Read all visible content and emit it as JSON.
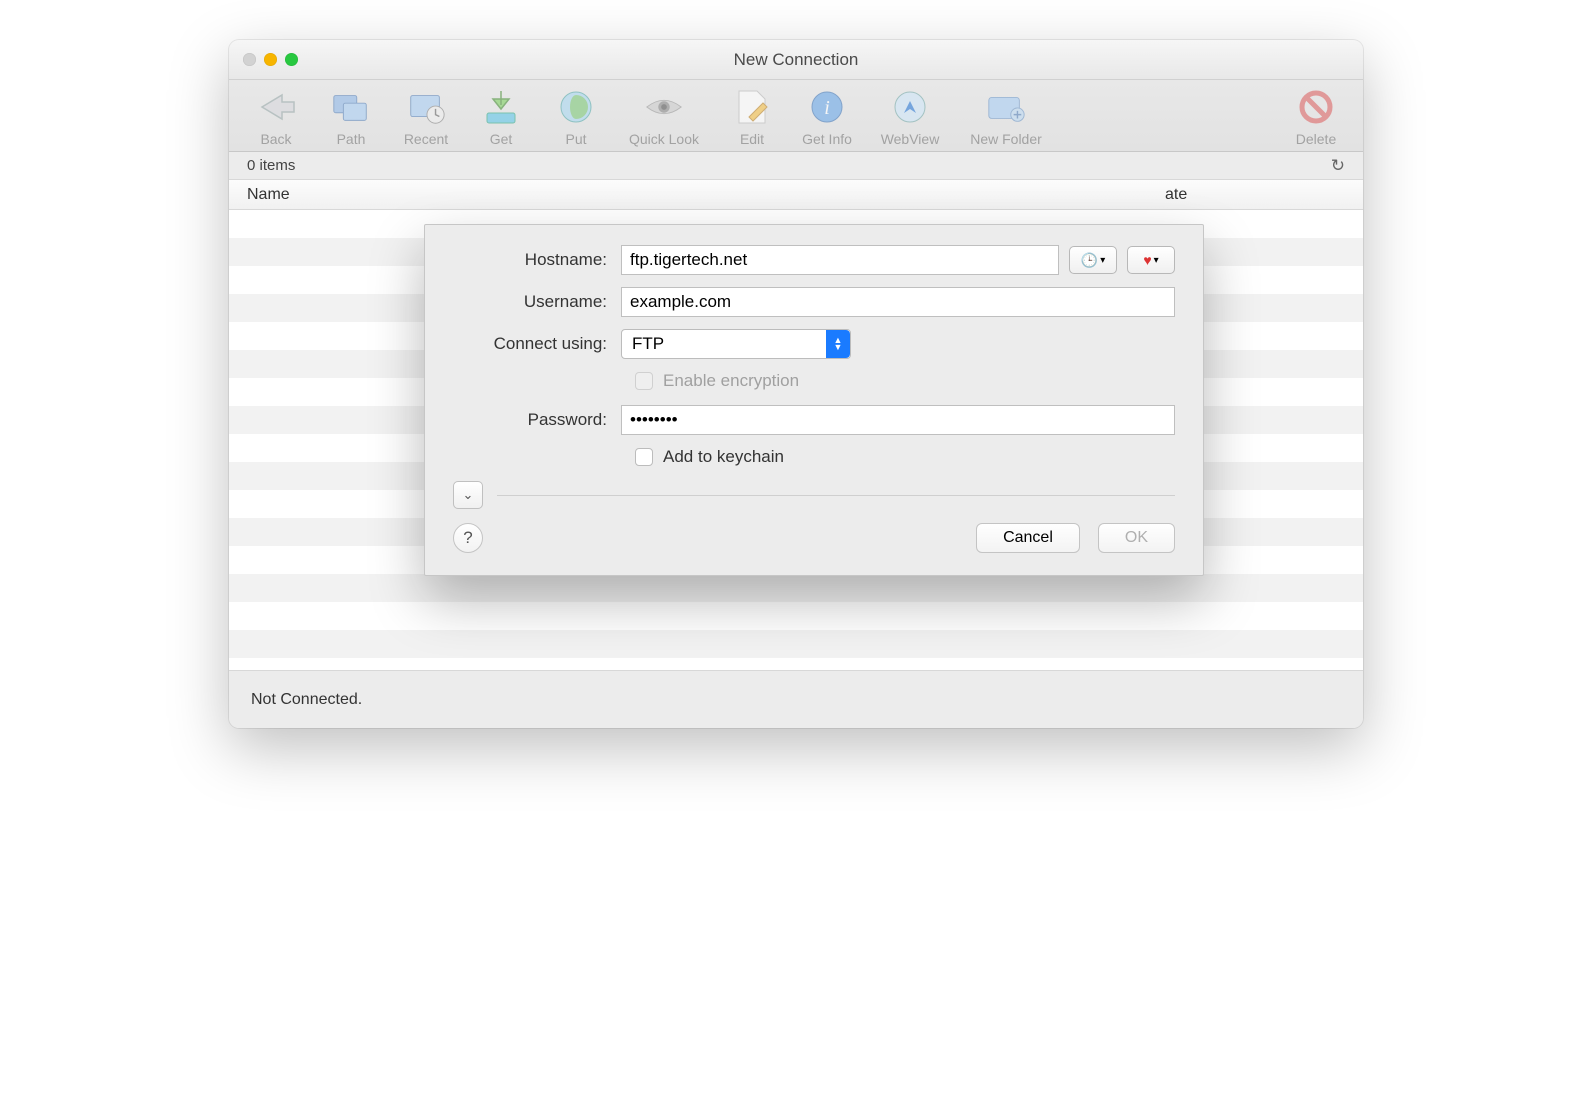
{
  "window": {
    "title": "New Connection"
  },
  "toolbar": {
    "items": [
      {
        "label": "Back"
      },
      {
        "label": "Path"
      },
      {
        "label": "Recent"
      },
      {
        "label": "Get"
      },
      {
        "label": "Put"
      },
      {
        "label": "Quick Look"
      },
      {
        "label": "Edit"
      },
      {
        "label": "Get Info"
      },
      {
        "label": "WebView"
      },
      {
        "label": "New Folder"
      }
    ],
    "right": {
      "label": "Delete"
    }
  },
  "status": {
    "items_text": "0 items"
  },
  "columns": {
    "name": "Name",
    "date": "ate"
  },
  "footer": {
    "status": "Not Connected."
  },
  "dialog": {
    "labels": {
      "hostname": "Hostname:",
      "username": "Username:",
      "connect_using": "Connect using:",
      "password": "Password:"
    },
    "hostname": "ftp.tigertech.net",
    "username": "example.com",
    "protocol": "FTP",
    "enable_encryption": "Enable encryption",
    "password_display": "●●●●●●●●",
    "add_keychain": "Add to keychain",
    "buttons": {
      "cancel": "Cancel",
      "ok": "OK"
    }
  }
}
